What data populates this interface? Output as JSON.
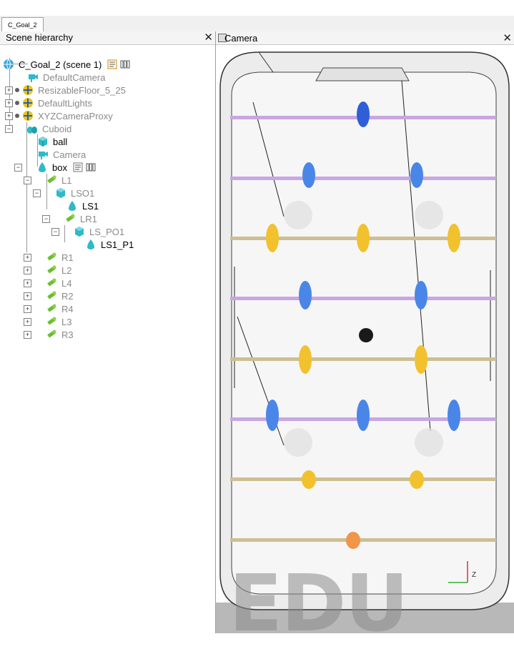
{
  "tabs": [
    {
      "label": "C_Goal_2"
    }
  ],
  "scene_panel": {
    "title": "Scene hierarchy",
    "root_label": "C_Goal_2 (scene 1)",
    "items": [
      {
        "label": "DefaultCamera",
        "icon": "camera-icon"
      },
      {
        "label": "ResizableFloor_5_25",
        "icon": "light-icon"
      },
      {
        "label": "DefaultLights",
        "icon": "light-icon"
      },
      {
        "label": "XYZCameraProxy",
        "icon": "light-icon"
      },
      {
        "label": "Cuboid",
        "icon": "shape-icon"
      },
      {
        "label": "ball",
        "icon": "cuboid-icon"
      },
      {
        "label": "Camera",
        "icon": "camera-icon"
      },
      {
        "label": "box",
        "icon": "shape-icon"
      },
      {
        "label": "L1",
        "icon": "joint-icon"
      },
      {
        "label": "LSO1",
        "icon": "cuboid-icon"
      },
      {
        "label": "LS1",
        "icon": "shape-icon"
      },
      {
        "label": "LR1",
        "icon": "joint-icon"
      },
      {
        "label": "LS_PO1",
        "icon": "cuboid-icon"
      },
      {
        "label": "LS1_P1",
        "icon": "shape-icon"
      },
      {
        "label": "R1",
        "icon": "joint-icon"
      },
      {
        "label": "L2",
        "icon": "joint-icon"
      },
      {
        "label": "L4",
        "icon": "joint-icon"
      },
      {
        "label": "R2",
        "icon": "joint-icon"
      },
      {
        "label": "R4",
        "icon": "joint-icon"
      },
      {
        "label": "L3",
        "icon": "joint-icon"
      },
      {
        "label": "R3",
        "icon": "joint-icon"
      }
    ]
  },
  "viewport": {
    "title": "Camera",
    "watermark": "EDU",
    "axis_label": "Z"
  },
  "colors": {
    "blue_team": "#4a86e8",
    "yellow_team": "#f2c12e",
    "purple_rod": "#c9a6e3",
    "tan_rod": "#cdbf94",
    "ball": "#1a1a1a",
    "goalie": "#f0954a"
  }
}
